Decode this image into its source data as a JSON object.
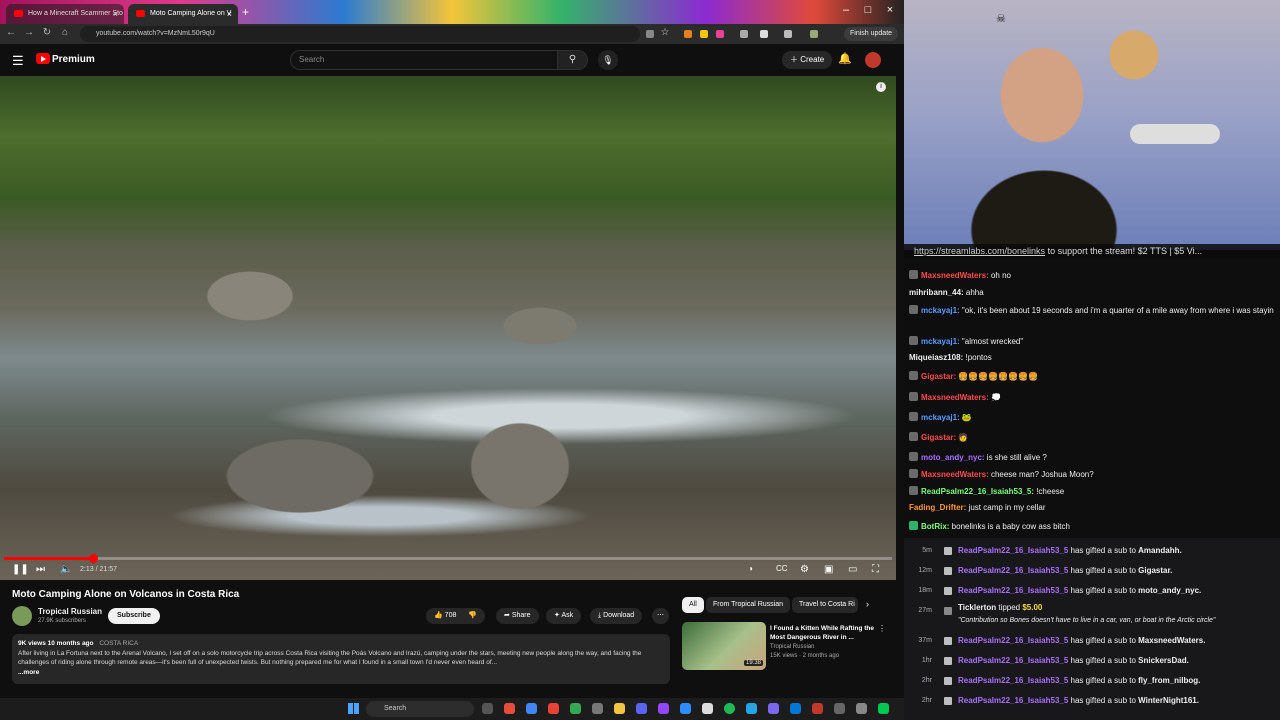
{
  "browser": {
    "tabs": [
      {
        "label": "How a Minecraft Scammer Sto"
      },
      {
        "label": "Moto Camping Alone on V"
      }
    ],
    "url": "youtube.com/watch?v=MzNmL50r9qU",
    "finish_update": "Finish update",
    "new_tab": "+"
  },
  "youtube": {
    "brand": "Premium",
    "search_placeholder": "Search",
    "create_label": "Create",
    "video": {
      "progress_fraction": 0.1,
      "time": "2:13 / 21:57",
      "title": "Moto Camping Alone on Volcanos in Costa Rica",
      "channel": "Tropical Russian",
      "subscribers": "27.9K subscribers",
      "subscribe_label": "Subscribe",
      "likes": "708",
      "share_label": "Share",
      "ask_label": "Ask",
      "download_label": "Download",
      "more_label": "⋯",
      "views_age": "9K views  10 months ago",
      "tag": "COSTA RICA",
      "description": "After living in La Fortuna next to the Arenal Volcano, I set off on a solo motorcycle trip across Costa Rica visiting the Poás Volcano and Irazú, camping under the stars, meeting new people along the way, and facing the challenges of riding alone through remote areas—it's been full of unexpected twists. But nothing prepared me for what I found in a small town I'd never even heard of...",
      "more_link": "...more"
    },
    "chips": [
      "All",
      "From Tropical Russian",
      "Travel to Costa Ri"
    ],
    "recommendation": {
      "title": "I Found a Kitten While Rafting the Most Dangerous River in ...",
      "channel": "Tropical Russian",
      "meta": "15K views · 2 months ago",
      "duration": "19:38"
    }
  },
  "taskbar": {
    "search_placeholder": "Search"
  },
  "stream": {
    "banner_link": "https://streamlabs.com/bonelinks",
    "banner_text": " to support the stream! $2 TTS | $5 Vi...",
    "chat": [
      {
        "user": "MaxsneedWaters:",
        "color": "#ff4d4d",
        "text": " oh no",
        "badge": true
      },
      {
        "user": "mihribann_44:",
        "color": "#efeff1",
        "text": " ahha",
        "badge": false
      },
      {
        "user": "mckayaj1:",
        "color": "#5b9cff",
        "text": " \"ok, it's been about 19 seconds and i'm a quarter of a mile away from where i was stayin",
        "badge": true
      },
      {
        "user": "mckayaj1:",
        "color": "#5b9cff",
        "text": " \"almost wrecked\"",
        "badge": true
      },
      {
        "user": "Miqueiasz108:",
        "color": "#efeff1",
        "text": " !pontos",
        "badge": false
      },
      {
        "user": "Gigastar:",
        "color": "#ff4d4d",
        "text": " 🍔🍔🍔🍔🍔🍔🍔🍔",
        "badge": true
      },
      {
        "user": "MaxsneedWaters:",
        "color": "#ff4d4d",
        "text": " 💭",
        "badge": true
      },
      {
        "user": "mckayaj1:",
        "color": "#5b9cff",
        "text": " 🐸",
        "badge": true
      },
      {
        "user": "Gigastar:",
        "color": "#ff4d4d",
        "text": " 🧑",
        "badge": true
      },
      {
        "user": "moto_andy_nyc:",
        "color": "#a970ff",
        "text": " is she still alive ?",
        "badge": true
      },
      {
        "user": "MaxsneedWaters:",
        "color": "#ff4d4d",
        "text": " cheese man? Joshua Moon?",
        "badge": true
      },
      {
        "user": "ReadPsalm22_16_Isaiah53_5:",
        "color": "#7fff7f",
        "text": " !cheese",
        "badge": true
      },
      {
        "user": "Fading_Drifter:",
        "color": "#ff9a3d",
        "text": " just camp in my cellar",
        "badge": false
      },
      {
        "user": "BotRix:",
        "color": "#7fff7f",
        "text": " bonelinks is a baby cow ass bitch",
        "badge": true
      }
    ],
    "events": [
      {
        "time": "5m",
        "user": "ReadPsalm22_16_Isaiah53_5",
        "text": " has gifted a sub to ",
        "target": "Amandahh."
      },
      {
        "time": "12m",
        "user": "ReadPsalm22_16_Isaiah53_5",
        "text": " has gifted a sub to ",
        "target": "Gigastar."
      },
      {
        "time": "18m",
        "user": "ReadPsalm22_16_Isaiah53_5",
        "text": " has gifted a sub to ",
        "target": "moto_andy_nyc."
      },
      {
        "time": "27m",
        "user": "Ticklerton",
        "text": " tipped ",
        "target": "$5.00",
        "message": "\"Contribution so Bones doesn't have to live in a car, van, or boat in the Arctic circle\""
      },
      {
        "time": "37m",
        "user": "ReadPsalm22_16_Isaiah53_5",
        "text": " has gifted a sub to ",
        "target": "MaxsneedWaters."
      },
      {
        "time": "1hr",
        "user": "ReadPsalm22_16_Isaiah53_5",
        "text": " has gifted a sub to ",
        "target": "SnickersDad."
      },
      {
        "time": "2hr",
        "user": "ReadPsalm22_16_Isaiah53_5",
        "text": " has gifted a sub to ",
        "target": "fly_from_nilbog."
      },
      {
        "time": "2hr",
        "user": "ReadPsalm22_16_Isaiah53_5",
        "text": " has gifted a sub to ",
        "target": "WinterNight161."
      }
    ]
  }
}
